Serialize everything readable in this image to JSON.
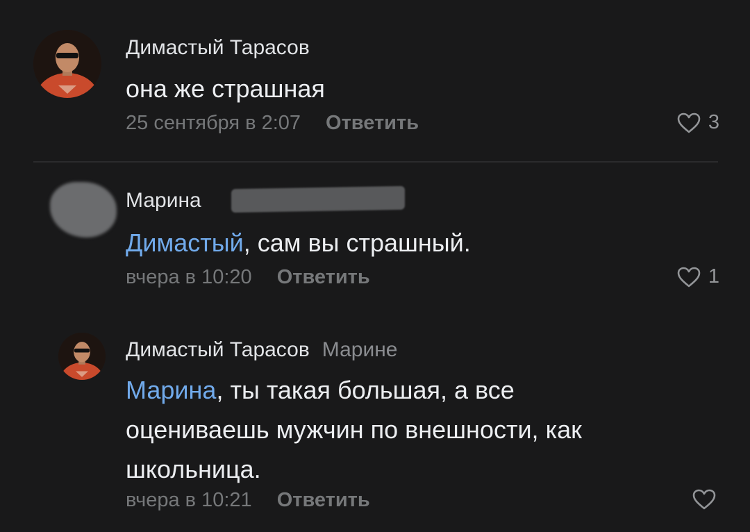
{
  "comments": [
    {
      "author": "Димастый Тарасов",
      "text": "она же страшная",
      "date": "25 сентября в 2:07",
      "reply_label": "Ответить",
      "likes": "3"
    },
    {
      "author": "Марина",
      "mention": "Димастый",
      "text": ", сам вы страшный.",
      "date": "вчера в 10:20",
      "reply_label": "Ответить",
      "likes": "1"
    },
    {
      "author": "Димастый Тарасов",
      "reply_to": "Марине",
      "mention": "Марина",
      "text_line1": ", ты такая большая, а все",
      "text_line2": "оцениваешь мужчин по внешности, как",
      "text_line3": "школьница.",
      "date": "вчера в 10:21",
      "reply_label": "Ответить"
    }
  ],
  "colors": {
    "background": "#19191a",
    "mention": "#71aaeb",
    "secondary": "#76787a"
  },
  "icons": [
    "heart-outline-icon",
    "avatar-photo"
  ]
}
